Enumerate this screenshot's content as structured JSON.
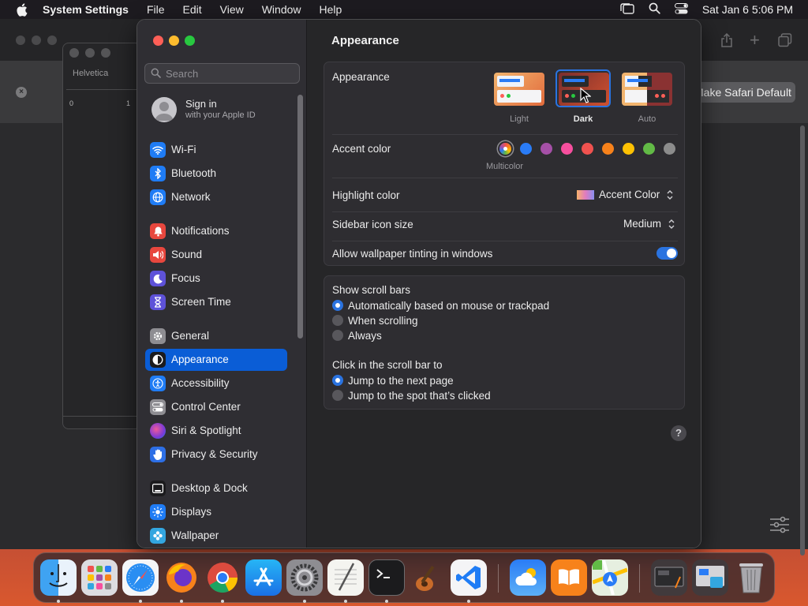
{
  "menubar": {
    "app_name": "System Settings",
    "menus": [
      "File",
      "Edit",
      "View",
      "Window",
      "Help"
    ],
    "clock": "Sat Jan 6  5:06 PM"
  },
  "background_safari": {
    "default_button": "Make Safari Default",
    "textedit_font": "Helvetica",
    "ruler_0": "0",
    "ruler_1": "1"
  },
  "sidebar": {
    "search_placeholder": "Search",
    "signin_title": "Sign in",
    "signin_subtitle": "with your Apple ID",
    "items": [
      {
        "label": "Wi-Fi",
        "icon": "wifi-icon",
        "color": "#1f7cf5"
      },
      {
        "label": "Bluetooth",
        "icon": "bluetooth-icon",
        "color": "#1f7cf5"
      },
      {
        "label": "Network",
        "icon": "globe-icon",
        "color": "#1f7cf5"
      },
      {
        "label": "Notifications",
        "icon": "bell-icon",
        "color": "#e8473e"
      },
      {
        "label": "Sound",
        "icon": "speaker-icon",
        "color": "#e8473e"
      },
      {
        "label": "Focus",
        "icon": "moon-icon",
        "color": "#5e52d9"
      },
      {
        "label": "Screen Time",
        "icon": "hourglass-icon",
        "color": "#5e52d9"
      },
      {
        "label": "General",
        "icon": "gear-icon",
        "color": "#8e8d92"
      },
      {
        "label": "Appearance",
        "icon": "appearance-icon",
        "color": "#1b1b1d"
      },
      {
        "label": "Accessibility",
        "icon": "accessibility-icon",
        "color": "#1f7cf5"
      },
      {
        "label": "Control Center",
        "icon": "control-center-icon",
        "color": "#8e8d92"
      },
      {
        "label": "Siri & Spotlight",
        "icon": "siri-icon",
        "color": "#b93ad6"
      },
      {
        "label": "Privacy & Security",
        "icon": "hand-icon",
        "color": "#2d6fe6"
      },
      {
        "label": "Desktop & Dock",
        "icon": "dock-icon",
        "color": "#1b1b1d"
      },
      {
        "label": "Displays",
        "icon": "sun-icon",
        "color": "#1f7cf5"
      },
      {
        "label": "Wallpaper",
        "icon": "wallpaper-icon",
        "color": "#33a6e0"
      }
    ],
    "selected": "Appearance"
  },
  "main": {
    "title": "Appearance",
    "appearance_label": "Appearance",
    "themes": [
      {
        "label": "Light"
      },
      {
        "label": "Dark"
      },
      {
        "label": "Auto"
      }
    ],
    "selected_theme": "Dark",
    "accent_label": "Accent color",
    "accent_colors": [
      "multicolor",
      "#2a7cf6",
      "#a550a7",
      "#f74f9e",
      "#f0524f",
      "#f7821b",
      "#fdc103",
      "#62ba46",
      "#8c8c8c"
    ],
    "accent_selected_caption": "Multicolor",
    "highlight_label": "Highlight color",
    "highlight_value": "Accent Color",
    "icon_size_label": "Sidebar icon size",
    "icon_size_value": "Medium",
    "tinting_label": "Allow wallpaper tinting in windows",
    "tinting_on": true,
    "scrollbars_heading": "Show scroll bars",
    "scrollbars_options": [
      "Automatically based on mouse or trackpad",
      "When scrolling",
      "Always"
    ],
    "scrollbars_selected": 0,
    "click_heading": "Click in the scroll bar to",
    "click_options": [
      "Jump to the next page",
      "Jump to the spot that’s clicked"
    ],
    "click_selected": 0,
    "help": "?"
  },
  "dock": {
    "apps": [
      "Finder",
      "Launchpad",
      "Safari",
      "Firefox",
      "Chrome",
      "App Store",
      "System Settings",
      "TextEdit",
      "Terminal",
      "GarageBand",
      "Visual Studio Code",
      "Weather",
      "Books",
      "Maps",
      "Screenshot",
      "Preview",
      "Trash"
    ]
  }
}
